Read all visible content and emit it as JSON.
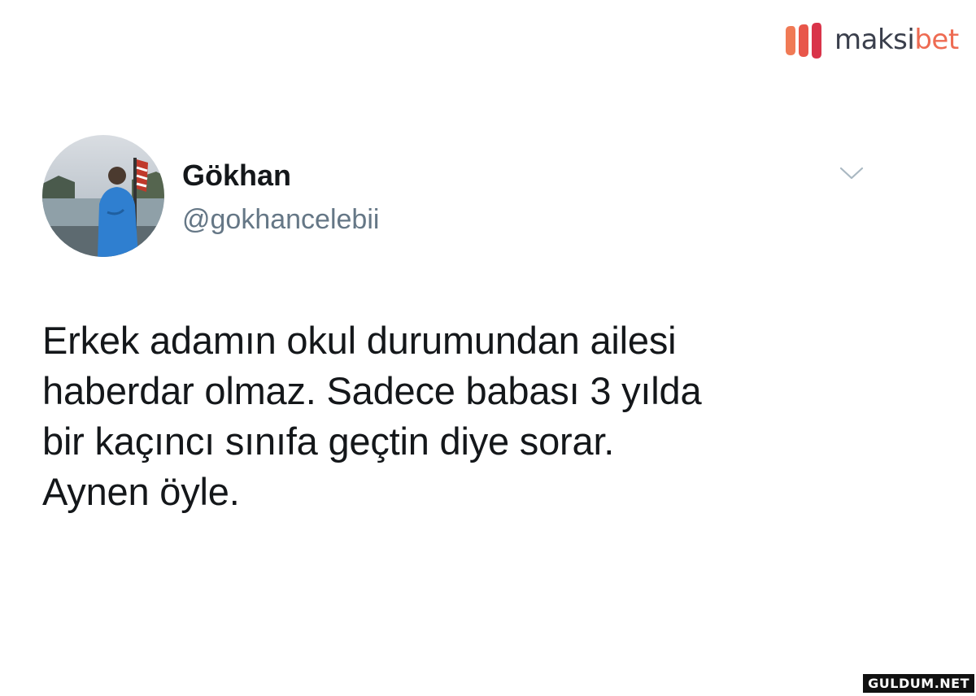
{
  "brand": {
    "name_part1": "maksi",
    "name_part2": "bet",
    "logo_icon": "maksibet-m-logo",
    "accent_color": "#ee6b52",
    "text_color": "#3a3f4c"
  },
  "tweet": {
    "avatar_icon": "profile-photo",
    "display_name": "Gökhan",
    "handle": "@gokhancelebii",
    "menu_icon": "chevron-down-icon",
    "text": "Erkek adamın okul durumundan ailesi\nhaberdar olmaz. Sadece babası 3 yılda\nbir kaçıncı sınıfa geçtin diye sorar.\nAynen öyle."
  },
  "watermark": {
    "text": "GULDUM.NET"
  }
}
